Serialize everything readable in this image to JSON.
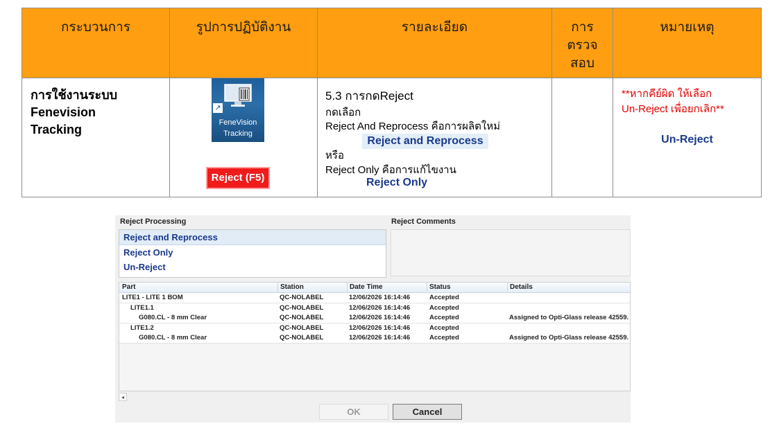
{
  "table": {
    "headers": [
      "กระบวนการ",
      "รูปการปฏิบัติงาน",
      "รายละเอียด",
      "การ\nตรวจ\nสอบ",
      "หมายเหตุ"
    ],
    "process_lines": [
      "การใช้งานระบบ",
      "Fenevision",
      "Tracking"
    ],
    "app_icon": {
      "line1": "FeneVision",
      "line2": "Tracking",
      "icon": "fenevision-app-icon"
    },
    "reject_f5_label": "Reject (F5)",
    "detail": {
      "title": "5.3 การกดReject",
      "line1": "กดเลือก",
      "line2": "Reject And Reprocess คือการผลิตใหม่",
      "btn_reprocess": "Reject and Reprocess",
      "line3": "หรือ",
      "line4": "Reject Only  คือการแก้ไขงาน",
      "btn_only": "Reject Only"
    },
    "note": {
      "line1": "**หากคีย์ผิด ให้เลือก",
      "line2": "Un-Reject เพื่อยกเลิก**",
      "unreject": "Un-Reject"
    }
  },
  "dialog": {
    "reject_processing_label": "Reject Processing",
    "reject_comments_label": "Reject Comments",
    "options": [
      "Reject and Reprocess",
      "Reject Only",
      "Un-Reject"
    ],
    "columns": [
      "Part",
      "Station",
      "Date Time",
      "Status",
      "Details"
    ],
    "rows": [
      {
        "part": "LITE1 - LITE 1 BOM",
        "indent": 0,
        "station": "QC-NOLABEL",
        "datetime": "12/06/2026 16:14:46",
        "status": "Accepted",
        "details": ""
      },
      {
        "part": "LITE1.1",
        "indent": 1,
        "station": "QC-NOLABEL",
        "datetime": "12/06/2026 16:14:46",
        "status": "Accepted",
        "details": ""
      },
      {
        "part": "G080.CL - 8 mm Clear",
        "indent": 2,
        "station": "QC-NOLABEL",
        "datetime": "12/06/2026 16:14:46",
        "status": "Accepted",
        "details": "Assigned to Opti-Glass release 42559."
      },
      {
        "part": "LITE1.2",
        "indent": 1,
        "station": "QC-NOLABEL",
        "datetime": "12/06/2026 16:14:46",
        "status": "Accepted",
        "details": ""
      },
      {
        "part": "G080.CL - 8 mm Clear",
        "indent": 2,
        "station": "QC-NOLABEL",
        "datetime": "12/06/2026 16:14:46",
        "status": "Accepted",
        "details": "Assigned to Opti-Glass release 42559."
      }
    ],
    "ok_label": "OK",
    "cancel_label": "Cancel",
    "scroll_left_glyph": "◂"
  },
  "colors": {
    "header_bg": "#ff9e10",
    "note_red": "#e00000",
    "option_blue": "#1a3a8a",
    "reject_btn": "#f01b1b"
  }
}
